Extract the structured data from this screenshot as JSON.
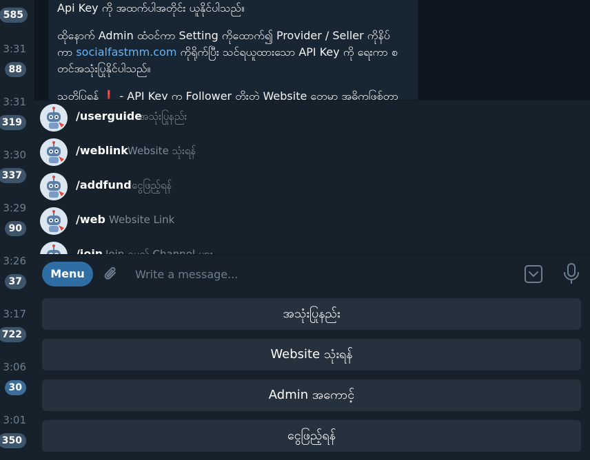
{
  "chat_list": [
    {
      "time": "",
      "badge": "585",
      "badge_style": "grey"
    },
    {
      "time": "3:31",
      "badge": "88",
      "badge_style": "grey"
    },
    {
      "time": "3:31",
      "badge": "319",
      "badge_style": "grey"
    },
    {
      "time": "3:30",
      "badge": "337",
      "badge_style": "grey"
    },
    {
      "time": "3:29",
      "badge": "90",
      "badge_style": "grey"
    },
    {
      "time": "3:26",
      "badge": "37",
      "badge_style": "grey"
    },
    {
      "time": "3:17",
      "badge": "722",
      "badge_style": "grey"
    },
    {
      "time": "3:06",
      "badge": "30",
      "badge_style": "blue"
    },
    {
      "time": "3:01",
      "badge": "350",
      "badge_style": "grey"
    }
  ],
  "message": {
    "line1": "Api Key ကို အထက်ပါအတိုင်း ယူနိုင်ပါသည်။",
    "para2_a": "ထိုနောက် Admin ထံဝင်ကာ Setting ကိုထောက်၍ Provider / Seller ကိုနိပ်",
    "para2_b_pre": "ကာ ",
    "link": "socialfastmm.com",
    "para2_b_post": " ကိုရိုက်ပြီး သင်ရယူထားသော API Key ကို ရေးကာ စ",
    "para2_c": "တင်အသုံးပြုနိုင်ပါသည်။",
    "para3_pre": "သတိပြုရန် ",
    "alert_mark": "❗",
    "para3_post": " - API Key က Follower တိုးတဲ့ Website တွေမှာ အဓိကဖြစ်တာ"
  },
  "commands": [
    {
      "name": "/userguide",
      "desc": "အသုံးပြုနည်း"
    },
    {
      "name": "/weblink",
      "desc": "Website သုံးရန်"
    },
    {
      "name": "/addfund",
      "desc": "ငွေဖြည့်ရန်"
    },
    {
      "name": "/web",
      "desc": "Website Link"
    },
    {
      "name": "/join",
      "desc": "Join ရမည့် Channel များ"
    }
  ],
  "composer": {
    "menu_label": "Menu",
    "placeholder": "Write a message..."
  },
  "keyboard": [
    "အသုံးပြုနည်း",
    "Website သုံးရန်",
    "Admin အကောင့်",
    "ငွေဖြည့်ရန်"
  ],
  "colors": {
    "accent": "#2f6ea5",
    "link": "#6ab3f3",
    "bubble": "#182533",
    "panel": "#17212b"
  }
}
